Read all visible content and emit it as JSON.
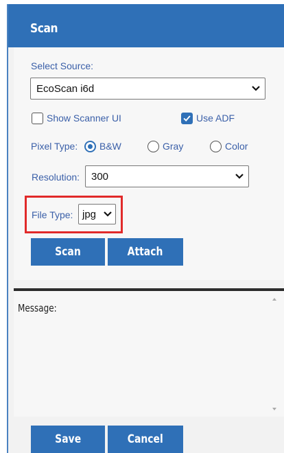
{
  "header": {
    "title": "Scan"
  },
  "scan": {
    "source_label": "Select Source:",
    "source_value": "EcoScan i6d",
    "show_scanner_ui_label": "Show Scanner UI",
    "show_scanner_ui_checked": false,
    "use_adf_label": "Use ADF",
    "use_adf_checked": true,
    "pixel_type_label": "Pixel Type:",
    "pixel_options": [
      {
        "label": "B&W",
        "selected": true
      },
      {
        "label": "Gray",
        "selected": false
      },
      {
        "label": "Color",
        "selected": false
      }
    ],
    "resolution_label": "Resolution:",
    "resolution_value": "300",
    "file_type_label": "File Type:",
    "file_type_value": "jpg"
  },
  "actions": {
    "scan_label": "Scan",
    "attach_label": "Attach"
  },
  "message": {
    "label": "Message:"
  },
  "footer": {
    "save_label": "Save",
    "cancel_label": "Cancel"
  },
  "colors": {
    "accent": "#2f70b7",
    "highlight": "#e12a2a",
    "label": "#3a5fa8"
  }
}
